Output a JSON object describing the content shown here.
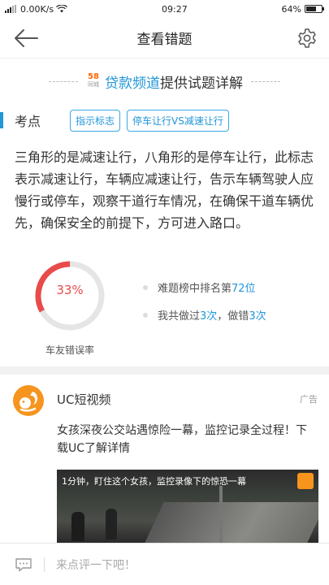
{
  "status_bar": {
    "speed": "0.00K/s",
    "time": "09:27",
    "battery_text": "64%",
    "battery_level": 0.64
  },
  "nav": {
    "title": "查看错题",
    "back_icon": "back-arrow-icon",
    "settings_icon": "gear-icon"
  },
  "provider": {
    "logo_number": "58",
    "logo_sub": "同城",
    "brand": "贷款频道",
    "suffix": "提供试题详解"
  },
  "keypoint": {
    "label": "考点",
    "tags": [
      "指示标志",
      "停车让行VS减速让行"
    ]
  },
  "explanation": "三角形的是减速让行，八角形的是停车让行，此标志表示减速让行，车辆应减速让行，告示车辆驾驶人应慢行或停车，观察干道行车情况，在确保干道车辆优先，确保安全的前提下，方可进入路口。",
  "stats": {
    "error_rate_label": "33%",
    "error_rate": 0.33,
    "caption": "车友错误率",
    "rank_prefix": "难题榜中排名第",
    "rank_value": "72位",
    "done_prefix": "我共做过",
    "done_value": "3次",
    "wrong_prefix": "，做错",
    "wrong_value": "3次",
    "colors": {
      "ring_error": "#e94b4b",
      "ring_track": "#e5e5e5",
      "highlight": "#2196d9"
    }
  },
  "ad": {
    "name": "UC短视频",
    "badge": "广告",
    "text": "女孩深夜公交站遇惊险一幕，监控记录全过程！下载UC了解详情",
    "video_caption": "1分钟，盯住这个女孩，监控录像下的惊恐一幕"
  },
  "comment": {
    "placeholder": "来点评一下吧！"
  }
}
